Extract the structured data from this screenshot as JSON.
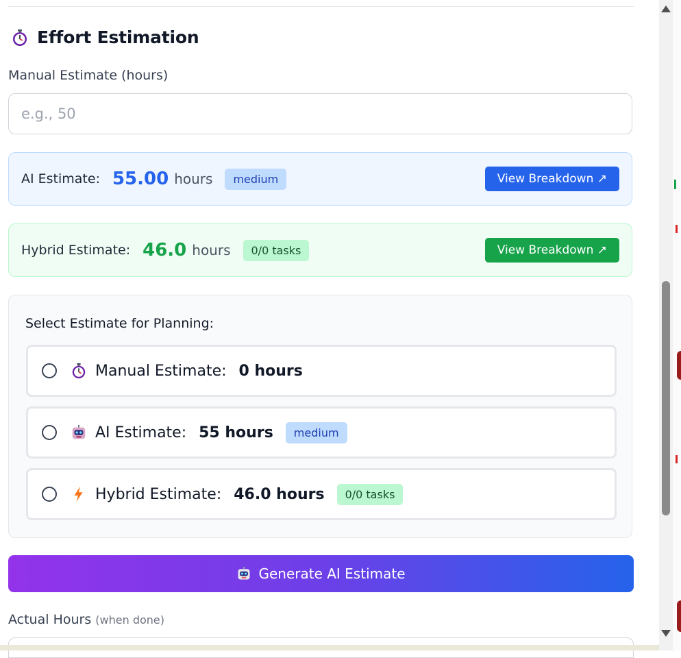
{
  "section": {
    "title": "Effort Estimation",
    "icon": "stopwatch-icon"
  },
  "manual": {
    "label": "Manual Estimate (hours)",
    "placeholder": "e.g., 50",
    "value": ""
  },
  "ai_card": {
    "label": "AI Estimate:",
    "value": "55.00",
    "unit": "hours",
    "badge": "medium",
    "button": "View Breakdown ↗"
  },
  "hybrid_card": {
    "label": "Hybrid Estimate:",
    "value": "46.0",
    "unit": "hours",
    "badge": "0/0 tasks",
    "button": "View Breakdown ↗"
  },
  "planning": {
    "title": "Select Estimate for Planning:",
    "options": [
      {
        "icon": "stopwatch-icon",
        "label": "Manual Estimate:",
        "value": "0 hours",
        "badge": "",
        "selected": false
      },
      {
        "icon": "robot-icon",
        "label": "AI Estimate:",
        "value": "55 hours",
        "badge": "medium",
        "selected": false
      },
      {
        "icon": "lightning-icon",
        "label": "Hybrid Estimate:",
        "value": "46.0 hours",
        "badge": "0/0 tasks",
        "selected": false
      }
    ]
  },
  "generate_button": {
    "label": "Generate AI Estimate",
    "icon": "robot-icon"
  },
  "actual": {
    "label": "Actual Hours",
    "sub": "(when done)"
  },
  "colors": {
    "ai_accent": "#2563eb",
    "hybrid_accent": "#16a34a",
    "gradient_start": "#9333ea",
    "gradient_end": "#2563eb"
  }
}
